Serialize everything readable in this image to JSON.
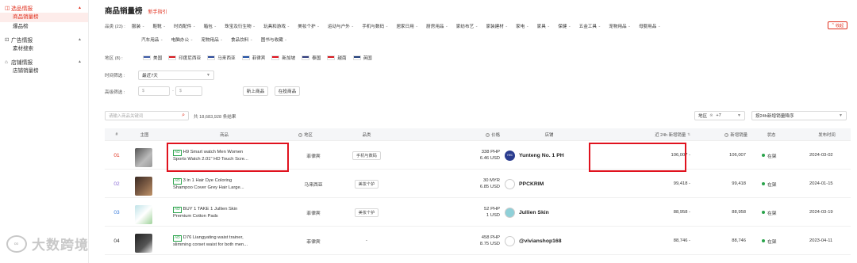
{
  "sidebar": {
    "groups": [
      {
        "label": "选品情报",
        "items": [
          "商品销量榜",
          "爆品榜"
        ]
      },
      {
        "label": "广告情报",
        "items": [
          "素材搜索"
        ]
      },
      {
        "label": "店铺情报",
        "items": [
          "店铺销量榜"
        ]
      }
    ]
  },
  "header": {
    "title": "商品销量榜",
    "guide": "新手指引"
  },
  "filters": {
    "category_label": "品类 (23) :",
    "categories_row1": [
      "服装",
      "鞋靴",
      "时尚配件",
      "箱包",
      "珠宝及衍生物",
      "玩具和游戏",
      "美妆个护",
      "运动与户外",
      "手机与数码",
      "居家日用",
      "厨房用品",
      "家纺布艺",
      "家装建材",
      "家电",
      "家具",
      "保健",
      "五金工具",
      "宠物用品",
      "母婴用品"
    ],
    "categories_row2": [
      "汽车用品",
      "电脑办公",
      "宠物用品",
      "食品饮料",
      "图书与收藏"
    ],
    "collapse_label": "收起",
    "region_label": "地区 (8) :",
    "regions": [
      {
        "name": "美国",
        "color": "#3c5aa6"
      },
      {
        "name": "印度尼西亚",
        "color": "#d71920"
      },
      {
        "name": "马来西亚",
        "color": "#2b4a9a"
      },
      {
        "name": "菲律宾",
        "color": "#1f4fa3"
      },
      {
        "name": "新加坡",
        "color": "#e0121e"
      },
      {
        "name": "泰国",
        "color": "#2e3a7c"
      },
      {
        "name": "越南",
        "color": "#d71920"
      },
      {
        "name": "英国",
        "color": "#1f3d7a"
      }
    ],
    "time_label": "时间筛选 :",
    "time_value": "最近7天",
    "advanced_label": "高级筛选 :",
    "price_min_placeholder": "$",
    "price_max_placeholder": "$",
    "new_product_btn": "新上商品",
    "onsale_btn": "在投商品"
  },
  "search": {
    "placeholder": "请输入商品关键词",
    "total": "共 18,683,928 条结果"
  },
  "right_controls": {
    "region_select": "地区",
    "region_extra": "+7",
    "sort_select": "按24h新增销量降序"
  },
  "table": {
    "headers": [
      "#",
      "主图",
      "商品",
      "地区",
      "品类",
      "价格",
      "店铺",
      "近 24h 新增销量",
      "新增销量",
      "状态",
      "发布时间"
    ],
    "rows": [
      {
        "rank": "01",
        "ad": "AD",
        "name_line1": "H9 Smart watch Men Women",
        "name_line2": "Sports Watch 2.01\" HD Touch Scre...",
        "region": "菲律宾",
        "category": "手机与数码",
        "price_local": "338 PHP",
        "price_usd": "6.46 USD",
        "shop": "Yunteng No. 1 PH",
        "shop_logo": "YWC",
        "sales_24h": "106,007 -",
        "total_sales": "106,007",
        "status": "在架",
        "date": "2024-03-02"
      },
      {
        "rank": "02",
        "ad": "AD",
        "name_line1": "3 in 1 Hair Dye Coloring",
        "name_line2": "Shampoo Cover Grey Hair Large...",
        "region": "马来西亚",
        "category": "美妆个护",
        "price_local": "30 MYR",
        "price_usd": "6.85 USD",
        "shop": "PPCKRIM",
        "shop_logo": "",
        "sales_24h": "99,418 -",
        "total_sales": "99,418",
        "status": "在架",
        "date": "2024-01-15"
      },
      {
        "rank": "03",
        "ad": "AD",
        "name_line1": "BUY 1 TAKE 1 Jullien Skin",
        "name_line2": "Premium Cotton Pads",
        "region": "菲律宾",
        "category": "美妆个护",
        "price_local": "52 PHP",
        "price_usd": "1 USD",
        "shop": "Jullien Skin",
        "shop_logo": "",
        "sales_24h": "88,958 -",
        "total_sales": "88,958",
        "status": "在架",
        "date": "2024-03-19"
      },
      {
        "rank": "04",
        "ad": "AD",
        "name_line1": "D76 Liangyating waist trainer,",
        "name_line2": "slimming corset waist for both men...",
        "region": "菲律宾",
        "category": "-",
        "price_local": "458 PHP",
        "price_usd": "8.75 USD",
        "shop": "@vivianshop168",
        "shop_logo": "",
        "sales_24h": "88,746 -",
        "total_sales": "88,746",
        "status": "在架",
        "date": "2023-04-11"
      }
    ]
  },
  "watermark": "大数跨境",
  "colors": {
    "accent": "#e0301e",
    "green": "#2aa34b",
    "highlight_box": "#e0121e"
  }
}
